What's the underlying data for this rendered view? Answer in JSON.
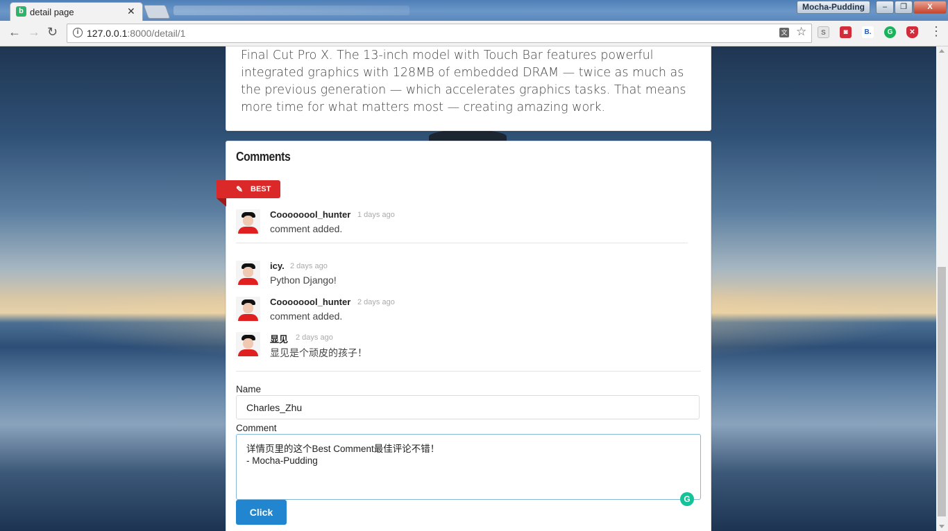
{
  "browser": {
    "tab_title": "detail page",
    "tab_favicon": "b",
    "profile_name": "Mocha-Pudding",
    "url_host": "127.0.0.1",
    "url_path": ":8000/detail/1",
    "window_buttons": {
      "minimize": "–",
      "maximize": "❐",
      "close": "X"
    },
    "extensions": [
      "shield-icon",
      "pocket-icon",
      "bookmark-icon",
      "grammarly-icon",
      "ublock-icon"
    ]
  },
  "article": {
    "text": "Final Cut Pro X. The 13-inch model with Touch Bar features powerful integrated graphics with 128MB of embedded DRAM — twice as much as the previous generation — which accelerates graphics tasks. That means more time for what matters most — creating amazing work."
  },
  "comments": {
    "title": "Comments",
    "best_label": "BEST",
    "best": {
      "author": "Coooooool_hunter",
      "time": "1 days ago",
      "text": "comment added."
    },
    "items": [
      {
        "author": "icy.",
        "time": "2 days ago",
        "text": "Python Django!"
      },
      {
        "author": "Coooooool_hunter",
        "time": "2 days ago",
        "text": "comment added."
      },
      {
        "author": "显见",
        "time": "2 days ago",
        "text": "显见是个顽皮的孩子！"
      }
    ]
  },
  "form": {
    "name_label": "Name",
    "name_value": "Charles_Zhu",
    "comment_label": "Comment",
    "comment_value": "详情页里的这个Best Comment最佳评论不错！\n- Mocha-Pudding",
    "submit_label": "Click"
  },
  "colors": {
    "accent": "#2185d0",
    "best_ribbon": "#db2828"
  }
}
